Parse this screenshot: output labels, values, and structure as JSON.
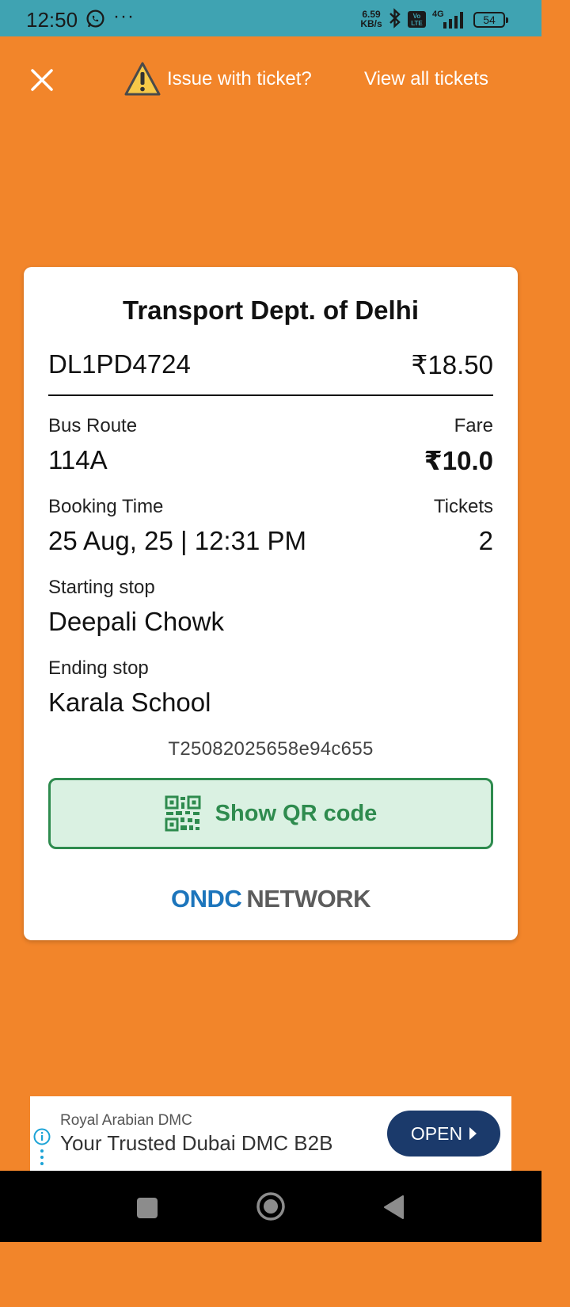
{
  "status_bar": {
    "time": "12:50",
    "dots": "···",
    "net_speed_value": "6.59",
    "net_speed_unit": "KB/s",
    "volte": "Vo\nLTE",
    "network_type": "4G",
    "battery": "54"
  },
  "topbar": {
    "close_icon": "close-icon",
    "issue_label": "Issue with ticket?",
    "view_all_label": "View all tickets"
  },
  "ticket": {
    "operator": "Transport Dept. of Delhi",
    "vehicle_number": "DL1PD4724",
    "total_amount": "₹18.50",
    "bus_route_label": "Bus Route",
    "bus_route": "114A",
    "fare_label": "Fare",
    "fare": "₹10.0",
    "booking_time_label": "Booking Time",
    "booking_time": "25 Aug, 25 | 12:31 PM",
    "tickets_label": "Tickets",
    "tickets": "2",
    "starting_stop_label": "Starting stop",
    "starting_stop": "Deepali Chowk",
    "ending_stop_label": "Ending stop",
    "ending_stop": "Karala School",
    "ticket_id": "T25082025658e94c655",
    "qr_button_label": "Show QR code",
    "network_brand_a": "ONDC",
    "network_brand_b": "NETWORK"
  },
  "ad": {
    "sponsor": "Royal Arabian DMC",
    "headline": "Your Trusted Dubai DMC B2B",
    "cta": "OPEN"
  },
  "colors": {
    "background": "#F2852A",
    "status_bar": "#3FA3B2",
    "qr_green": "#2E8B4E",
    "ondc_blue": "#1C75BC",
    "ad_button": "#1B3A6B"
  }
}
